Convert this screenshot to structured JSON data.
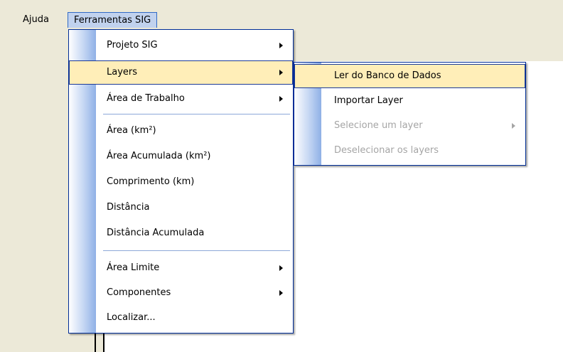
{
  "menubar": {
    "items": [
      {
        "label": "Ajuda"
      },
      {
        "label": "Ferramentas SIG"
      }
    ]
  },
  "toolbar": {
    "buttons": [
      {
        "icon": "play-icon",
        "color": "#f2c200"
      },
      {
        "icon": "record-icon",
        "color": "#e8141a"
      }
    ]
  },
  "menu_ferramentas": {
    "items": [
      {
        "label": "Projeto SIG",
        "submenu": true
      },
      {
        "label": "Layers",
        "submenu": true,
        "highlighted": true
      },
      {
        "label": "Área de Trabalho",
        "submenu": true
      },
      {
        "label": "Área (km²)",
        "submenu": false
      },
      {
        "label": "Área Acumulada (km²)",
        "submenu": false
      },
      {
        "label": "Comprimento (km)",
        "submenu": false
      },
      {
        "label": "Distância",
        "submenu": false
      },
      {
        "label": "Distância Acumulada",
        "submenu": false
      },
      {
        "label": "Área Limite",
        "submenu": true
      },
      {
        "label": "Componentes",
        "submenu": true
      },
      {
        "label": "Localizar...",
        "submenu": false
      }
    ]
  },
  "menu_layers": {
    "items": [
      {
        "label": "Ler do Banco de Dados",
        "enabled": true,
        "highlighted": true
      },
      {
        "label": "Importar Layer",
        "enabled": true
      },
      {
        "label": "Selecione um layer",
        "enabled": false,
        "submenu": true
      },
      {
        "label": "Deselecionar os layers",
        "enabled": false
      }
    ]
  },
  "colors": {
    "menu_highlight": "#ffeeb8",
    "menu_border": "#002d96",
    "disabled_text": "#a5a5a5"
  }
}
